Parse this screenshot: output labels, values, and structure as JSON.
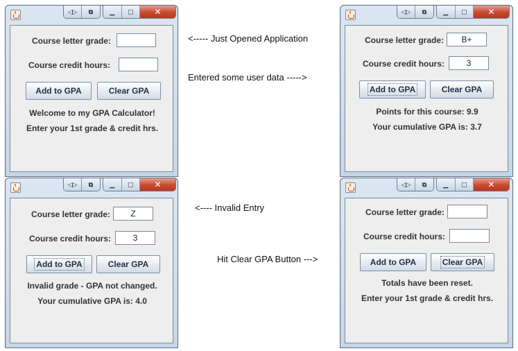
{
  "windows": [
    {
      "grade_label": "Course letter grade:",
      "credit_label": "Course credit hours:",
      "grade_value": "",
      "credit_value": "",
      "add_button": "Add to GPA",
      "clear_button": "Clear GPA",
      "message_line1": "Welcome to my GPA Calculator!",
      "message_line2": "Enter your 1st grade & credit hrs."
    },
    {
      "grade_label": "Course letter grade:",
      "credit_label": "Course credit hours:",
      "grade_value": "B+",
      "credit_value": "3",
      "add_button": "Add to GPA",
      "clear_button": "Clear GPA",
      "message_line1": "Points for this course: 9.9",
      "message_line2": "Your cumulative GPA is: 3.7"
    },
    {
      "grade_label": "Course letter grade:",
      "credit_label": "Course credit hours:",
      "grade_value": "Z",
      "credit_value": "3",
      "add_button": "Add to GPA",
      "clear_button": "Clear GPA",
      "message_line1": "Invalid grade - GPA not changed.",
      "message_line2": "Your cumulative GPA is: 4.0"
    },
    {
      "grade_label": "Course letter grade:",
      "credit_label": "Course credit hours:",
      "grade_value": "",
      "credit_value": "",
      "add_button": "Add to GPA",
      "clear_button": "Clear GPA",
      "message_line1": "Totals have been reset.",
      "message_line2": "Enter your 1st grade & credit hrs."
    }
  ],
  "annotations": {
    "just_opened": "<----- Just Opened Application",
    "entered_data": "Entered some user data ----->",
    "invalid_entry": "<---- Invalid Entry",
    "hit_clear": "Hit Clear GPA Button --->"
  },
  "icons": {
    "app": "java-app-icon",
    "titlebar_a": "back-forward-icon",
    "titlebar_b": "restore-window-icon",
    "minimize": "minimize-icon",
    "maximize": "maximize-icon",
    "close": "close-icon"
  },
  "colors": {
    "window_frame": "#c6d6e9",
    "client_background": "#eeeeee",
    "close_button": "#c74a30"
  }
}
